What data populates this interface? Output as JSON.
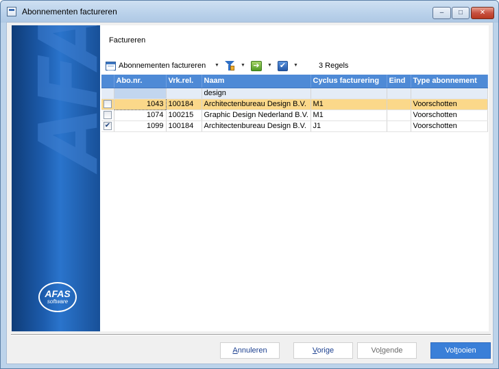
{
  "window": {
    "title": "Abonnementen factureren",
    "controls": {
      "minimize": "‒",
      "maximize": "□",
      "close": "✕"
    }
  },
  "side_panel": {
    "watermark": "AFAS",
    "logo_main": "AFAS",
    "logo_sub": "software"
  },
  "section_title": "Factureren",
  "toolbar": {
    "view_label": "Abonnementen factureren",
    "goto_glyph": "➔",
    "check_glyph": "✔",
    "dropdown_glyph": "▼",
    "count": "3 Regels",
    "icons": [
      "grid-view-icon",
      "filter-icon",
      "go-to-icon",
      "check-icon"
    ]
  },
  "grid": {
    "columns": [
      "",
      "Abo.nr.",
      "Vrk.rel.",
      "Naam",
      "Cyclus facturering",
      "Eind",
      "Type abonnement"
    ],
    "filter": {
      "naam": "design"
    },
    "rows": [
      {
        "checked": "",
        "abo": "1043",
        "vrk": "100184",
        "naam": "Architectenbureau Design B.V.",
        "cyclus": "M1",
        "eind": "",
        "type": "Voorschotten"
      },
      {
        "checked": "",
        "abo": "1074",
        "vrk": "100215",
        "naam": "Graphic Design Nederland B.V.",
        "cyclus": "M1",
        "eind": "",
        "type": "Voorschotten"
      },
      {
        "checked": "✔",
        "abo": "1099",
        "vrk": "100184",
        "naam": "Architectenbureau Design B.V.",
        "cyclus": "J1",
        "eind": "",
        "type": "Voorschotten"
      }
    ],
    "selected_row_color": "#fbd88a",
    "header_color": "#4e8ad6"
  },
  "buttons": {
    "cancel_mnemonic": "A",
    "cancel_rest": "nnuleren",
    "prev_mnemonic": "V",
    "prev_rest": "orige",
    "next_pre": "Vo",
    "next_mnemonic": "l",
    "next_rest": "gende",
    "finish_pre": "Vol",
    "finish_mnemonic": "t",
    "finish_rest": "ooien"
  }
}
